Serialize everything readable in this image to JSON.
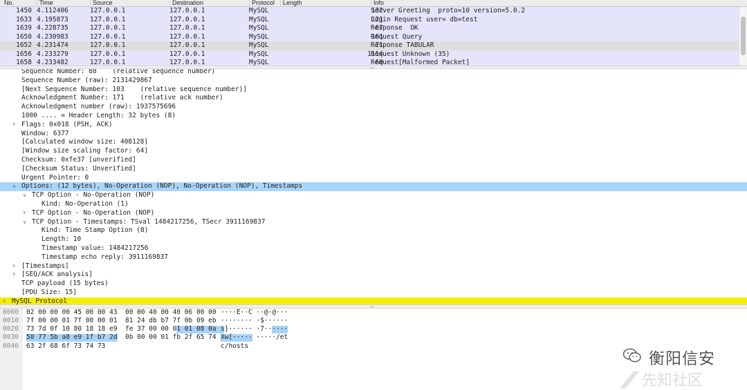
{
  "packet_list": {
    "columns": [
      "No.",
      "Time",
      "Source",
      "Destination",
      "Protocol",
      "Length",
      "Info"
    ],
    "rows": [
      {
        "no": "1450",
        "time": "4.112406",
        "src": "127.0.0.1",
        "dst": "127.0.0.1",
        "proto": "MySQL",
        "len": "132",
        "info": "Server Greeting  proto=10 version=5.0.2",
        "selected": false
      },
      {
        "no": "1633",
        "time": "4.195873",
        "src": "127.0.0.1",
        "dst": "127.0.0.1",
        "proto": "MySQL",
        "len": "121",
        "info": "Login Request user= db=test",
        "selected": false
      },
      {
        "no": "1639",
        "time": "4.228735",
        "src": "127.0.0.1",
        "dst": "127.0.0.1",
        "proto": "MySQL",
        "len": "67",
        "info": "Response  OK",
        "selected": false
      },
      {
        "no": "1650",
        "time": "4.230983",
        "src": "127.0.0.1",
        "dst": "127.0.0.1",
        "proto": "MySQL",
        "len": "161",
        "info": "Request Query",
        "selected": false
      },
      {
        "no": "1652",
        "time": "4.231474",
        "src": "127.0.0.1",
        "dst": "127.0.0.1",
        "proto": "MySQL",
        "len": "71",
        "info": "Response TABULAR",
        "selected": true
      },
      {
        "no": "1656",
        "time": "4.233279",
        "src": "127.0.0.1",
        "dst": "127.0.0.1",
        "proto": "MySQL",
        "len": "1114",
        "info": "Request Unknown (35)",
        "selected": false
      },
      {
        "no": "1658",
        "time": "4.233482",
        "src": "127.0.0.1",
        "dst": "127.0.0.1",
        "proto": "MySQL",
        "len": "60",
        "info": "Request[Malformed Packet]",
        "selected": false
      }
    ]
  },
  "details": [
    {
      "indent": 0,
      "arrow": "",
      "text": "Sequence Number: 88    (relative sequence number)"
    },
    {
      "indent": 0,
      "arrow": "",
      "text": "Sequence Number (raw): 2131429867"
    },
    {
      "indent": 0,
      "arrow": "",
      "text": "[Next Sequence Number: 103    (relative sequence number)]"
    },
    {
      "indent": 0,
      "arrow": "",
      "text": "Acknowledgment Number: 171    (relative ack number)"
    },
    {
      "indent": 0,
      "arrow": "",
      "text": "Acknowledgment number (raw): 1937575696"
    },
    {
      "indent": 0,
      "arrow": "",
      "text": "1000 .... = Header Length: 32 bytes (8)"
    },
    {
      "indent": 0,
      "arrow": "collapsed",
      "text": "Flags: 0x018 (PSH, ACK)"
    },
    {
      "indent": 0,
      "arrow": "",
      "text": "Window: 6377"
    },
    {
      "indent": 0,
      "arrow": "",
      "text": "[Calculated window size: 408128]"
    },
    {
      "indent": 0,
      "arrow": "",
      "text": "[Window size scaling factor: 64]"
    },
    {
      "indent": 0,
      "arrow": "",
      "text": "Checksum: 0xfe37 [unverified]"
    },
    {
      "indent": 0,
      "arrow": "",
      "text": "[Checksum Status: Unverified]"
    },
    {
      "indent": 0,
      "arrow": "",
      "text": "Urgent Pointer: 0"
    },
    {
      "indent": 0,
      "arrow": "expanded",
      "text": "Options: (12 bytes), No-Operation (NOP), No-Operation (NOP), Timestamps",
      "selected": true
    },
    {
      "indent": 1,
      "arrow": "expanded",
      "text": "TCP Option - No-Operation (NOP)"
    },
    {
      "indent": 2,
      "arrow": "",
      "text": "Kind: No-Operation (1)"
    },
    {
      "indent": 1,
      "arrow": "collapsed",
      "text": "TCP Option - No-Operation (NOP)"
    },
    {
      "indent": 1,
      "arrow": "expanded",
      "text": "TCP Option - Timestamps: TSval 1484217256, TSecr 3911169837"
    },
    {
      "indent": 2,
      "arrow": "",
      "text": "Kind: Time Stamp Option (8)"
    },
    {
      "indent": 2,
      "arrow": "",
      "text": "Length: 10"
    },
    {
      "indent": 2,
      "arrow": "",
      "text": "Timestamp value: 1484217256"
    },
    {
      "indent": 2,
      "arrow": "",
      "text": "Timestamp echo reply: 3911169837"
    },
    {
      "indent": 0,
      "arrow": "collapsed",
      "text": "[Timestamps]"
    },
    {
      "indent": 0,
      "arrow": "collapsed",
      "text": "[SEQ/ACK analysis]"
    },
    {
      "indent": 0,
      "arrow": "",
      "text": "TCP payload (15 bytes)"
    },
    {
      "indent": 0,
      "arrow": "",
      "text": "[PDU Size: 15]"
    },
    {
      "indent": -1,
      "arrow": "collapsed",
      "text": "MySQL Protocol",
      "mysql": true
    }
  ],
  "hex": [
    {
      "offset": "0000",
      "bytes": "02 00 00 00 45 00 00 43  00 00 40 00 40 06 00 00",
      "ascii": "····E··C ··@·@···"
    },
    {
      "offset": "0010",
      "bytes": "7f 00 00 01 7f 00 00 01  81 24 db b7 7f 0b 09 eb",
      "ascii": "········ ·$······"
    },
    {
      "offset": "0020",
      "bytes": "73 7d 0f 10 80 18 18 e9  fe 37 00 00 01 01 08 0a",
      "ascii": "s}······ ·7······"
    },
    {
      "offset": "0030",
      "bytes": "58 77 5b a8 e9 1f b7 2d  0b 00 00 01 fb 2f 65 74",
      "ascii": "Xw[····- ·····/et"
    },
    {
      "offset": "0040",
      "bytes": "63 2f 68 6f 73 74 73",
      "ascii": "c/hosts"
    }
  ],
  "watermark": {
    "text": "衡阳信安",
    "ghost": "先知社区"
  }
}
